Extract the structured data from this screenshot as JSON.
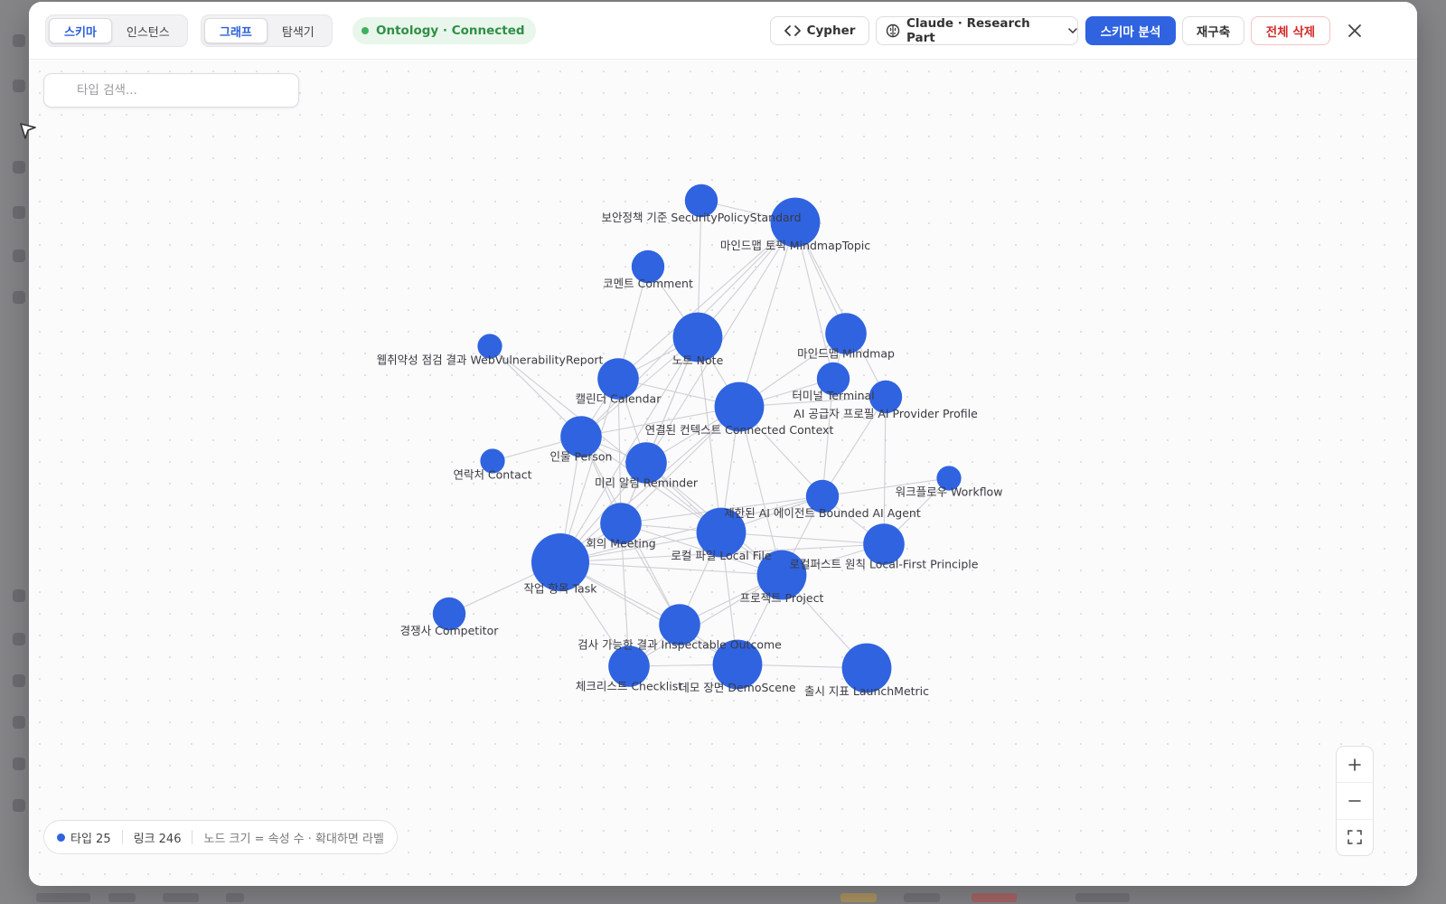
{
  "toolbar": {
    "view_tabs": [
      {
        "label": "스키마",
        "active": true
      },
      {
        "label": "인스턴스",
        "active": false
      }
    ],
    "mode_tabs": [
      {
        "label": "그래프",
        "active": true
      },
      {
        "label": "탐색기",
        "active": false
      }
    ],
    "status": "Ontology · Connected",
    "cypher_label": "Cypher",
    "model_select": "Claude · Research Part",
    "analyze_label": "스키마 분석",
    "rebuild_label": "재구축",
    "delete_all_label": "전체 삭제"
  },
  "search": {
    "placeholder": "타입 검색..."
  },
  "legend": {
    "types": "타입 25",
    "links": "링크 246",
    "hint": "노드 크기 = 속성 수 · 확대하면 라벨"
  },
  "colors": {
    "node": "#2f63e0",
    "edge": "#cfcfd4",
    "accent": "#2f63e0",
    "danger": "#d22d2d",
    "status": "#2f8f46"
  },
  "graph": {
    "nodes": [
      {
        "id": "security",
        "label": "보안정책 기준 SecurityPolicyStandard",
        "size": 2
      },
      {
        "id": "mindmaptopic",
        "label": "마인드맵 토픽 MindmapTopic",
        "size": 4
      },
      {
        "id": "comment",
        "label": "코멘트 Comment",
        "size": 2
      },
      {
        "id": "note",
        "label": "노트 Note",
        "size": 4
      },
      {
        "id": "mindmap",
        "label": "마인드맵 Mindmap",
        "size": 3
      },
      {
        "id": "webvuln",
        "label": "웹취약성 점검 결과 WebVulnerabilityReport",
        "size": 1
      },
      {
        "id": "calendar",
        "label": "캘린더 Calendar",
        "size": 3
      },
      {
        "id": "terminal",
        "label": "터미널 Terminal",
        "size": 2
      },
      {
        "id": "aiprovider",
        "label": "AI 공급자 프로필 AI Provider Profile",
        "size": 2
      },
      {
        "id": "context",
        "label": "연결된 컨텍스트 Connected Context",
        "size": 4
      },
      {
        "id": "person",
        "label": "인물 Person",
        "size": 3
      },
      {
        "id": "contact",
        "label": "연락처 Contact",
        "size": 1
      },
      {
        "id": "reminder",
        "label": "미리 알림 Reminder",
        "size": 3
      },
      {
        "id": "workflow",
        "label": "워크플로우 Workflow",
        "size": 1
      },
      {
        "id": "agent",
        "label": "제한된 AI 에이전트 Bounded AI Agent",
        "size": 2
      },
      {
        "id": "meeting",
        "label": "회의 Meeting",
        "size": 3
      },
      {
        "id": "localfile",
        "label": "로컬 파일 Local File",
        "size": 4
      },
      {
        "id": "localfirst",
        "label": "로컬퍼스트 원칙 Local-First Principle",
        "size": 3
      },
      {
        "id": "task",
        "label": "작업 항목 Task",
        "size": 5
      },
      {
        "id": "project",
        "label": "프로젝트 Project",
        "size": 4
      },
      {
        "id": "competitor",
        "label": "경쟁사 Competitor",
        "size": 2
      },
      {
        "id": "outcome",
        "label": "검사 가능한 결과 Inspectable Outcome",
        "size": 3
      },
      {
        "id": "checklist",
        "label": "체크리스트 Checklist",
        "size": 3
      },
      {
        "id": "demoscene",
        "label": "데모 장면 DemoScene",
        "size": 4
      },
      {
        "id": "launchmetric",
        "label": "출시 지표 LaunchMetric",
        "size": 4
      }
    ],
    "links": [
      [
        "security",
        "note"
      ],
      [
        "security",
        "mindmaptopic"
      ],
      [
        "mindmaptopic",
        "note"
      ],
      [
        "mindmaptopic",
        "mindmap"
      ],
      [
        "mindmaptopic",
        "calendar"
      ],
      [
        "mindmaptopic",
        "context"
      ],
      [
        "mindmaptopic",
        "person"
      ],
      [
        "mindmaptopic",
        "terminal"
      ],
      [
        "mindmaptopic",
        "aiprovider"
      ],
      [
        "mindmaptopic",
        "reminder"
      ],
      [
        "comment",
        "calendar"
      ],
      [
        "comment",
        "note"
      ],
      [
        "note",
        "calendar"
      ],
      [
        "note",
        "context"
      ],
      [
        "note",
        "person"
      ],
      [
        "note",
        "meeting"
      ],
      [
        "note",
        "localfile"
      ],
      [
        "note",
        "reminder"
      ],
      [
        "note",
        "task"
      ],
      [
        "mindmap",
        "context"
      ],
      [
        "mindmap",
        "terminal"
      ],
      [
        "webvuln",
        "person"
      ],
      [
        "webvuln",
        "localfile"
      ],
      [
        "calendar",
        "person"
      ],
      [
        "calendar",
        "meeting"
      ],
      [
        "calendar",
        "context"
      ],
      [
        "calendar",
        "reminder"
      ],
      [
        "calendar",
        "task"
      ],
      [
        "terminal",
        "context"
      ],
      [
        "terminal",
        "agent"
      ],
      [
        "aiprovider",
        "agent"
      ],
      [
        "aiprovider",
        "context"
      ],
      [
        "aiprovider",
        "localfirst"
      ],
      [
        "context",
        "person"
      ],
      [
        "context",
        "reminder"
      ],
      [
        "context",
        "localfile"
      ],
      [
        "context",
        "agent"
      ],
      [
        "context",
        "project"
      ],
      [
        "context",
        "task"
      ],
      [
        "context",
        "meeting"
      ],
      [
        "person",
        "contact"
      ],
      [
        "person",
        "task"
      ],
      [
        "person",
        "meeting"
      ],
      [
        "person",
        "reminder"
      ],
      [
        "person",
        "localfile"
      ],
      [
        "person",
        "outcome"
      ],
      [
        "reminder",
        "task"
      ],
      [
        "reminder",
        "meeting"
      ],
      [
        "reminder",
        "localfile"
      ],
      [
        "reminder",
        "project"
      ],
      [
        "workflow",
        "agent"
      ],
      [
        "workflow",
        "localfirst"
      ],
      [
        "agent",
        "localfile"
      ],
      [
        "agent",
        "project"
      ],
      [
        "agent",
        "localfirst"
      ],
      [
        "agent",
        "meeting"
      ],
      [
        "agent",
        "task"
      ],
      [
        "meeting",
        "localfile"
      ],
      [
        "meeting",
        "task"
      ],
      [
        "meeting",
        "project"
      ],
      [
        "meeting",
        "outcome"
      ],
      [
        "meeting",
        "checklist"
      ],
      [
        "localfile",
        "task"
      ],
      [
        "localfile",
        "project"
      ],
      [
        "localfile",
        "localfirst"
      ],
      [
        "localfile",
        "outcome"
      ],
      [
        "localfile",
        "demoscene"
      ],
      [
        "localfirst",
        "project"
      ],
      [
        "localfirst",
        "task"
      ],
      [
        "task",
        "project"
      ],
      [
        "task",
        "competitor"
      ],
      [
        "task",
        "outcome"
      ],
      [
        "task",
        "checklist"
      ],
      [
        "task",
        "demoscene"
      ],
      [
        "project",
        "outcome"
      ],
      [
        "project",
        "demoscene"
      ],
      [
        "project",
        "launchmetric"
      ],
      [
        "project",
        "checklist"
      ],
      [
        "outcome",
        "checklist"
      ],
      [
        "outcome",
        "demoscene"
      ],
      [
        "checklist",
        "demoscene"
      ],
      [
        "demoscene",
        "launchmetric"
      ]
    ]
  }
}
